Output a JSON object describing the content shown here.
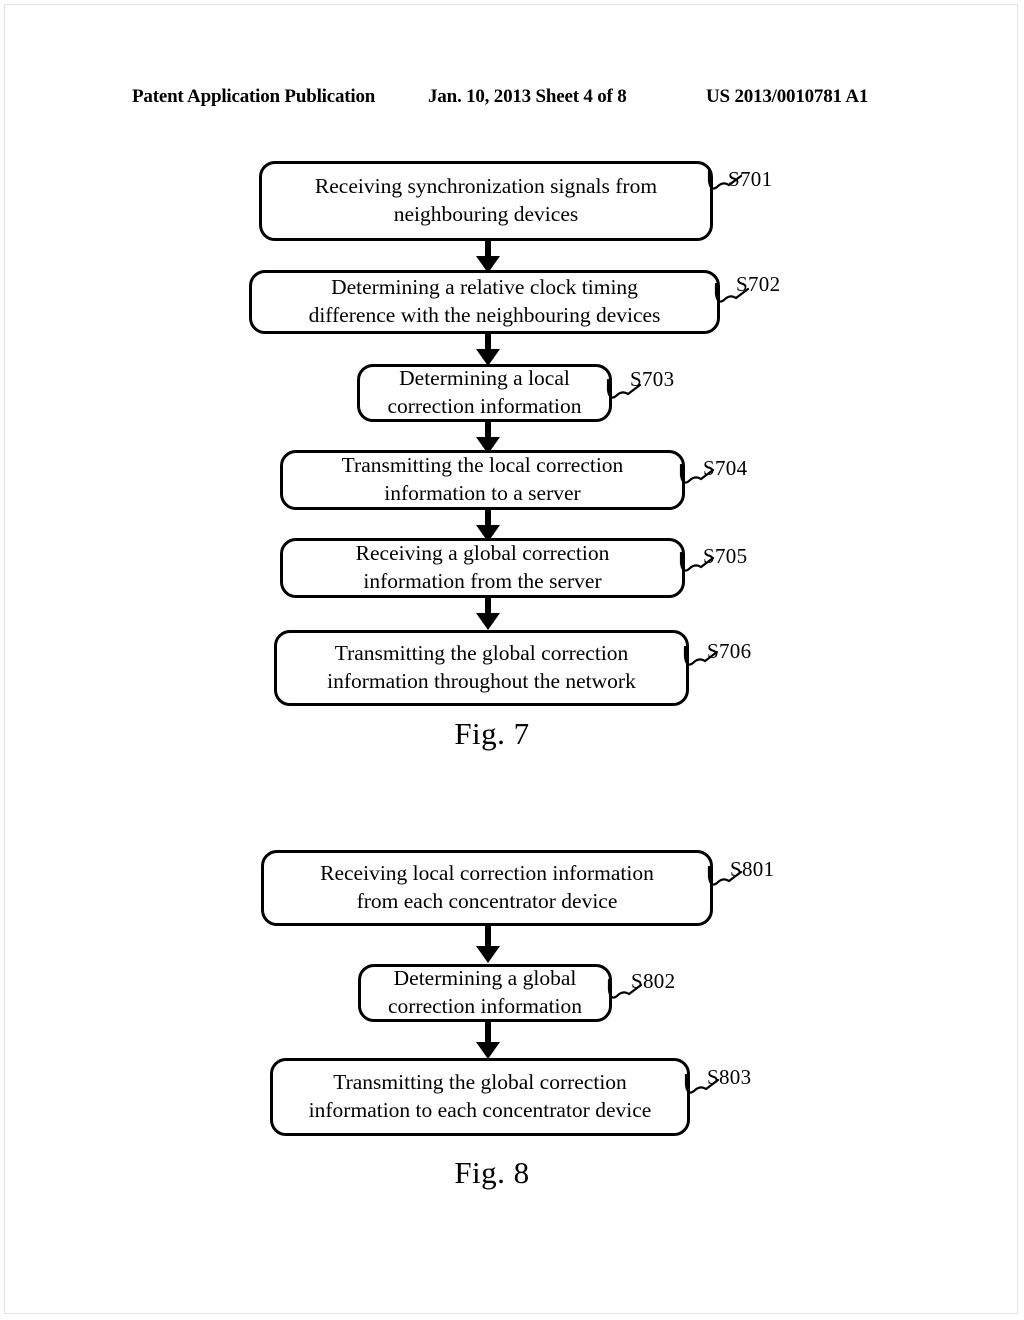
{
  "header": {
    "publication": "Patent Application Publication",
    "date_sheet": "Jan. 10, 2013  Sheet 4 of 8",
    "patent_number": "US 2013/0010781 A1"
  },
  "figures": [
    {
      "caption": "Fig. 7",
      "steps": [
        {
          "ref": "S701",
          "text": "Receiving synchronization signals from\nneighbouring devices"
        },
        {
          "ref": "S702",
          "text": "Determining a relative clock timing\ndifference with the neighbouring devices"
        },
        {
          "ref": "S703",
          "text": "Determining a local\ncorrection information"
        },
        {
          "ref": "S704",
          "text": "Transmitting the local correction\ninformation to a server"
        },
        {
          "ref": "S705",
          "text": "Receiving a global correction\ninformation from the server"
        },
        {
          "ref": "S706",
          "text": "Transmitting the global correction\ninformation throughout the network"
        }
      ]
    },
    {
      "caption": "Fig. 8",
      "steps": [
        {
          "ref": "S801",
          "text": "Receiving local correction information\nfrom each concentrator device"
        },
        {
          "ref": "S802",
          "text": "Determining a global\ncorrection information"
        },
        {
          "ref": "S803",
          "text": "Transmitting the global correction\ninformation to each concentrator device"
        }
      ]
    }
  ],
  "colors": {
    "ink": "#000000",
    "paper": "#ffffff"
  }
}
